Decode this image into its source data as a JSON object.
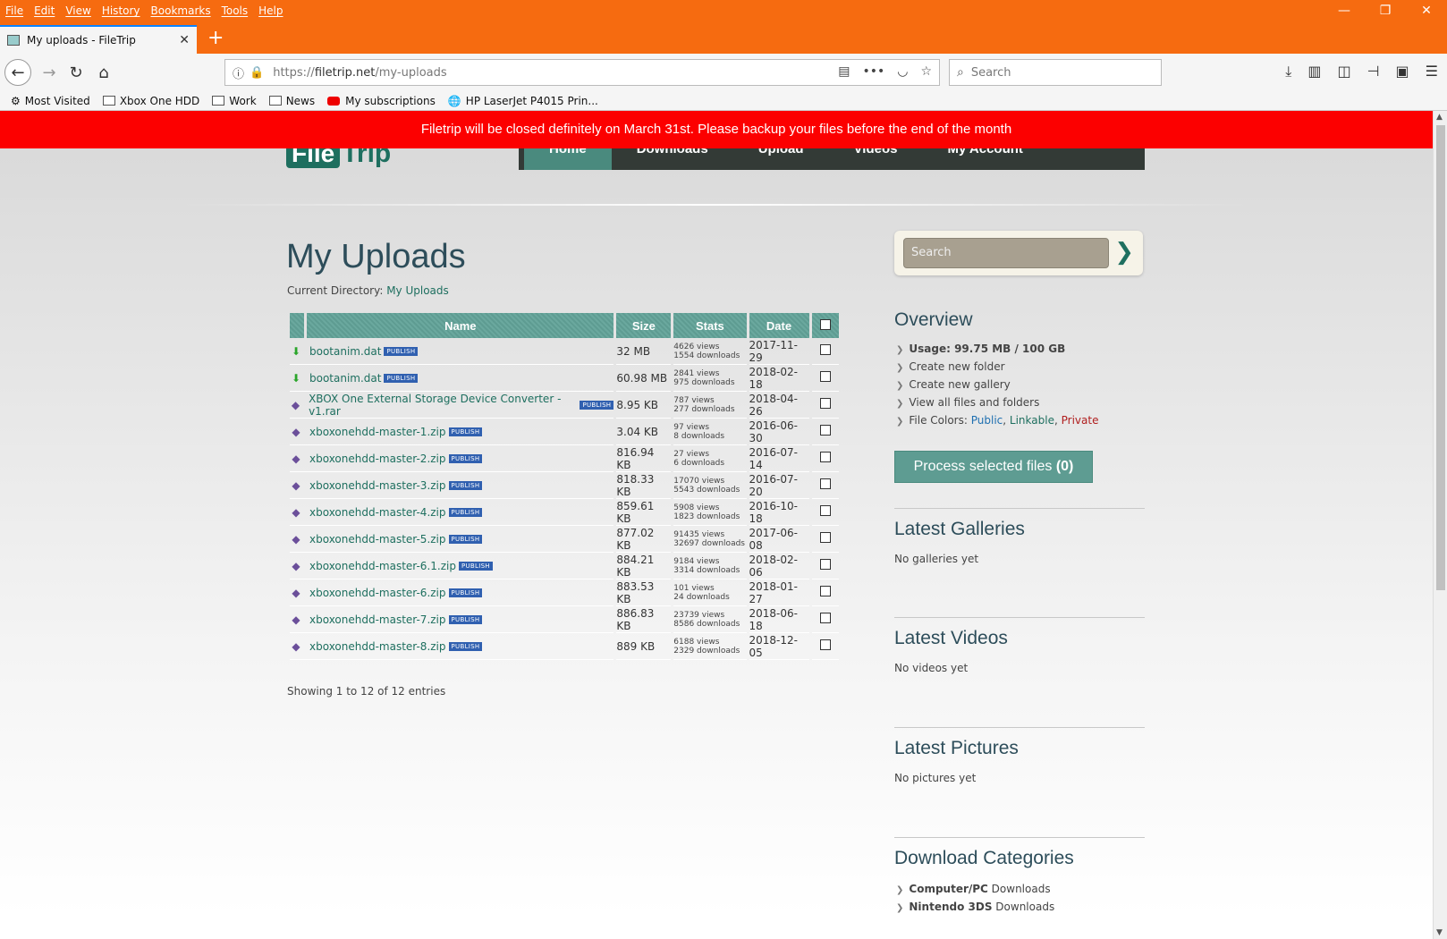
{
  "browser": {
    "menu": [
      "File",
      "Edit",
      "View",
      "History",
      "Bookmarks",
      "Tools",
      "Help"
    ],
    "tab_title": "My uploads - FileTrip",
    "url_prefix": "https://",
    "url_host": "filetrip.net",
    "url_path": "/my-uploads",
    "search_placeholder": "Search",
    "bookmarks": [
      "Most Visited",
      "Xbox One HDD",
      "Work",
      "News",
      "My subscriptions",
      "HP LaserJet P4015 Prin..."
    ]
  },
  "banner": "Filetrip will be closed definitely on March 31st. Please backup your files before the end of the month",
  "site": {
    "logo_a": "File",
    "logo_b": "Trip",
    "nav": [
      "Home",
      "Downloads",
      "Upload",
      "Videos",
      "My Account"
    ]
  },
  "page": {
    "title": "My Uploads",
    "curdir_label": "Current Directory:",
    "curdir_value": "My Uploads",
    "columns": [
      "Name",
      "Size",
      "Stats",
      "Date"
    ],
    "badge": "PUBLISH",
    "files": [
      {
        "name": "bootanim.dat",
        "type": "dl",
        "size": "32 MB",
        "views": "4626 views",
        "downloads": "1554 downloads",
        "date": "2017-11-29"
      },
      {
        "name": "bootanim.dat",
        "type": "dl",
        "size": "60.98 MB",
        "views": "2841 views",
        "downloads": "975 downloads",
        "date": "2018-02-18"
      },
      {
        "name": "XBOX One External Storage Device Converter - v1.rar",
        "type": "zip",
        "size": "8.95 KB",
        "views": "787 views",
        "downloads": "277 downloads",
        "date": "2018-04-26"
      },
      {
        "name": "xboxonehdd-master-1.zip",
        "type": "zip",
        "size": "3.04 KB",
        "views": "97 views",
        "downloads": "8 downloads",
        "date": "2016-06-30"
      },
      {
        "name": "xboxonehdd-master-2.zip",
        "type": "zip",
        "size": "816.94 KB",
        "views": "27 views",
        "downloads": "6 downloads",
        "date": "2016-07-14"
      },
      {
        "name": "xboxonehdd-master-3.zip",
        "type": "zip",
        "size": "818.33 KB",
        "views": "17070 views",
        "downloads": "5543 downloads",
        "date": "2016-07-20"
      },
      {
        "name": "xboxonehdd-master-4.zip",
        "type": "zip",
        "size": "859.61 KB",
        "views": "5908 views",
        "downloads": "1823 downloads",
        "date": "2016-10-18"
      },
      {
        "name": "xboxonehdd-master-5.zip",
        "type": "zip",
        "size": "877.02 KB",
        "views": "91435 views",
        "downloads": "32697 downloads",
        "date": "2017-06-08"
      },
      {
        "name": "xboxonehdd-master-6.1.zip",
        "type": "zip",
        "size": "884.21 KB",
        "views": "9184 views",
        "downloads": "3314 downloads",
        "date": "2018-02-06"
      },
      {
        "name": "xboxonehdd-master-6.zip",
        "type": "zip",
        "size": "883.53 KB",
        "views": "101 views",
        "downloads": "24 downloads",
        "date": "2018-01-27"
      },
      {
        "name": "xboxonehdd-master-7.zip",
        "type": "zip",
        "size": "886.83 KB",
        "views": "23739 views",
        "downloads": "8586 downloads",
        "date": "2018-06-18"
      },
      {
        "name": "xboxonehdd-master-8.zip",
        "type": "zip",
        "size": "889 KB",
        "views": "6188 views",
        "downloads": "2329 downloads",
        "date": "2018-12-05"
      }
    ],
    "showing": "Showing 1 to 12 of 12 entries"
  },
  "sidebar": {
    "search_placeholder": "Search",
    "overview_title": "Overview",
    "usage": "Usage: 99.75 MB / 100 GB",
    "links": [
      "Create new folder",
      "Create new gallery",
      "View all files and folders"
    ],
    "file_colors_label": "File Colors:",
    "color_public": "Public",
    "color_linkable": "Linkable",
    "color_private": "Private",
    "process_button": "Process selected files",
    "process_count": "(0)",
    "galleries_title": "Latest Galleries",
    "galleries_empty": "No galleries yet",
    "videos_title": "Latest Videos",
    "videos_empty": "No videos yet",
    "pictures_title": "Latest Pictures",
    "pictures_empty": "No pictures yet",
    "categories_title": "Download Categories",
    "categories": [
      {
        "bold": "Computer/PC",
        "rest": " Downloads"
      },
      {
        "bold": "Nintendo 3DS",
        "rest": " Downloads"
      }
    ]
  },
  "colors": {
    "accent": "#5e9c92",
    "banner": "#fc0000",
    "browser": "#f66b10"
  }
}
